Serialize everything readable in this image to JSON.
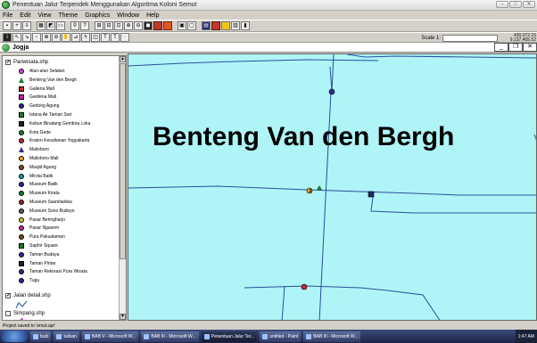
{
  "window": {
    "title": "Penentuan Jalur Terpendek Menggunakan Algoritma Koloni Semut",
    "buttons": [
      "minimize",
      "maximize",
      "close"
    ]
  },
  "menu": [
    "File",
    "Edit",
    "View",
    "Theme",
    "Graphics",
    "Window",
    "Help"
  ],
  "toolbar": {
    "scale_label": "Scale 1:",
    "scale_value": "",
    "coord_x": "430,072.15",
    "coord_y": "9,137,405.52"
  },
  "view": {
    "title": "Jogja"
  },
  "toc": {
    "themes": [
      {
        "name": "Pariwisata.shp",
        "checked": true
      },
      {
        "name": "Jalan detail.shp",
        "checked": true
      },
      {
        "name": "Simpang.shp",
        "checked": false
      }
    ],
    "legend": [
      {
        "label": "Alun-alun Selatan",
        "color": "#c84fd4",
        "shape": "circle"
      },
      {
        "label": "Benteng Van den Bergh",
        "color": "#1a7d2a",
        "shape": "triangle"
      },
      {
        "label": "Galleria Mall",
        "color": "#c82828",
        "shape": "square"
      },
      {
        "label": "Gardena Mall",
        "color": "#d01e9e",
        "shape": "square"
      },
      {
        "label": "Gedong Agung",
        "color": "#2c2c8c",
        "shape": "circle"
      },
      {
        "label": "Istana Air Taman Sari",
        "color": "#1a7d2a",
        "shape": "square"
      },
      {
        "label": "Kebun Binatang Gembira Loka",
        "color": "#202020",
        "shape": "square"
      },
      {
        "label": "Kota Gede",
        "color": "#1a7d2a",
        "shape": "circle"
      },
      {
        "label": "Kraton Kesultanan Yogyakarta",
        "color": "#c82828",
        "shape": "circle"
      },
      {
        "label": "Malioboro",
        "color": "#2c2c8c",
        "shape": "triangle"
      },
      {
        "label": "Malioboro Mall",
        "color": "#e6a817",
        "shape": "circle"
      },
      {
        "label": "Masjid Agung",
        "color": "#7a4a14",
        "shape": "circle"
      },
      {
        "label": "Mirota Batik",
        "color": "#1a9a9a",
        "shape": "circle"
      },
      {
        "label": "Museum Batik",
        "color": "#2c2c8c",
        "shape": "circle"
      },
      {
        "label": "Museum Kirata",
        "color": "#1a7d2a",
        "shape": "circle"
      },
      {
        "label": "Museum Sasmitaloka",
        "color": "#8c2c2c",
        "shape": "circle"
      },
      {
        "label": "Museum Sono Budoyo",
        "color": "#5a5a5a",
        "shape": "circle"
      },
      {
        "label": "Pasar Beringharjo",
        "color": "#d4c82c",
        "shape": "circle"
      },
      {
        "label": "Pasar Ngasem",
        "color": "#d01e9e",
        "shape": "circle"
      },
      {
        "label": "Pura Pakualaman",
        "color": "#7a4a14",
        "shape": "circle"
      },
      {
        "label": "Saphir Square",
        "color": "#1a7d2a",
        "shape": "square"
      },
      {
        "label": "Taman Budaya",
        "color": "#2c2c8c",
        "shape": "circle"
      },
      {
        "label": "Taman Pintar",
        "color": "#202020",
        "shape": "square"
      },
      {
        "label": "Taman Rekreasi Pura Wisata",
        "color": "#2c2c8c",
        "shape": "circle"
      },
      {
        "label": "Tugu",
        "color": "#2c2c8c",
        "shape": "circle"
      }
    ]
  },
  "map": {
    "label": "Benteng Van den Bergh",
    "background": "#aff4f6",
    "road_color": "#2a4fa0",
    "route_color": "#1a6e86"
  },
  "status": "Project saved to 'ernut.apr'",
  "taskbar": {
    "items": [
      "budi",
      "tulisan",
      "BAB V - Microsoft W...",
      "BAB III - Microsoft W...",
      "Penentuan Jalur Ter...",
      "untitled - Paint",
      "BAB III - Microsoft W..."
    ],
    "clock": "1:47 AM"
  }
}
